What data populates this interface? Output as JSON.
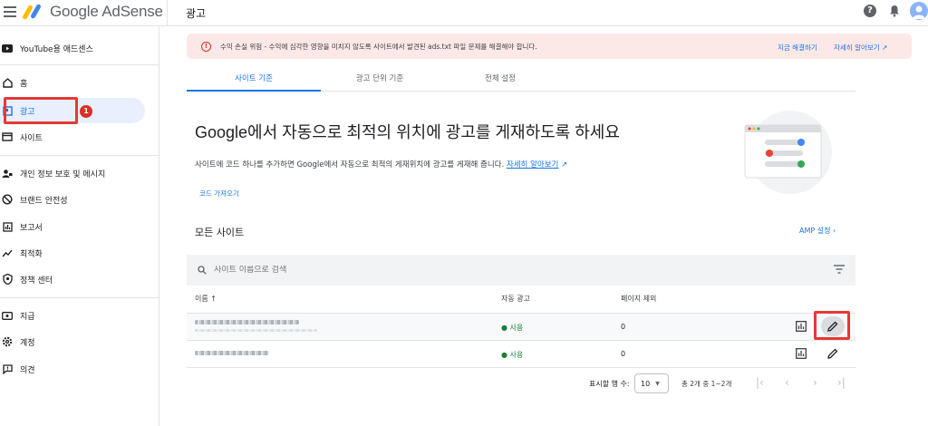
{
  "app": {
    "name": "Google AdSense",
    "page_title": "광고"
  },
  "sidebar": {
    "items": [
      {
        "label": "YouTube용 애드센스",
        "icon": "youtube-icon"
      },
      {
        "label": "홈",
        "icon": "home-icon"
      },
      {
        "label": "광고",
        "icon": "ads-icon"
      },
      {
        "label": "사이트",
        "icon": "sites-icon"
      },
      {
        "label": "개인 정보 보호 및 메시지",
        "icon": "privacy-icon"
      },
      {
        "label": "브랜드 안전성",
        "icon": "block-icon"
      },
      {
        "label": "보고서",
        "icon": "reports-icon"
      },
      {
        "label": "최적화",
        "icon": "optimization-icon"
      },
      {
        "label": "정책 센터",
        "icon": "policy-icon"
      },
      {
        "label": "지급",
        "icon": "payments-icon"
      },
      {
        "label": "계정",
        "icon": "gear-icon"
      },
      {
        "label": "의견",
        "icon": "feedback-icon"
      }
    ],
    "annotation_badge": "1"
  },
  "alert": {
    "text": "수익 손실 위험 - 수익에 심각한 영향을 미치지 않도록 사이트에서 발견된 ads.txt 파일 문제를 해결해야 합니다.",
    "fix_label": "지금 해결하기",
    "more_label": "자세히 알아보기"
  },
  "tabs": [
    {
      "label": "사이트 기준",
      "active": true
    },
    {
      "label": "광고 단위 기준",
      "active": false
    },
    {
      "label": "전체 설정",
      "active": false
    }
  ],
  "hero": {
    "title": "Google에서 자동으로 최적의 위치에 광고를 게재하도록 하세요",
    "description": "사이트에 코드 하나를 추가하면 Google에서 자동으로 최적의 게재위치에 광고를 게재해 줍니다.",
    "learn_more": "자세히 알아보기",
    "get_code": "코드 가져오기"
  },
  "sites": {
    "title": "모든 사이트",
    "amp_label": "AMP 설정",
    "search_placeholder": "사이트 이름으로 검색",
    "columns": [
      "이름 ↑",
      "자동 광고",
      "페이지 제외"
    ],
    "rows": [
      {
        "auto_ads": "사용",
        "excluded": "0"
      },
      {
        "auto_ads": "사용",
        "excluded": "0"
      }
    ]
  },
  "pagination": {
    "rows_label": "표시할 행 수:",
    "rows_value": "10",
    "range": "총 2개 중 1~2개"
  },
  "colors": {
    "accent": "#1a73e8",
    "alert_bg": "#fce8e6",
    "highlight": "#e53935",
    "status_green": "#188038"
  }
}
